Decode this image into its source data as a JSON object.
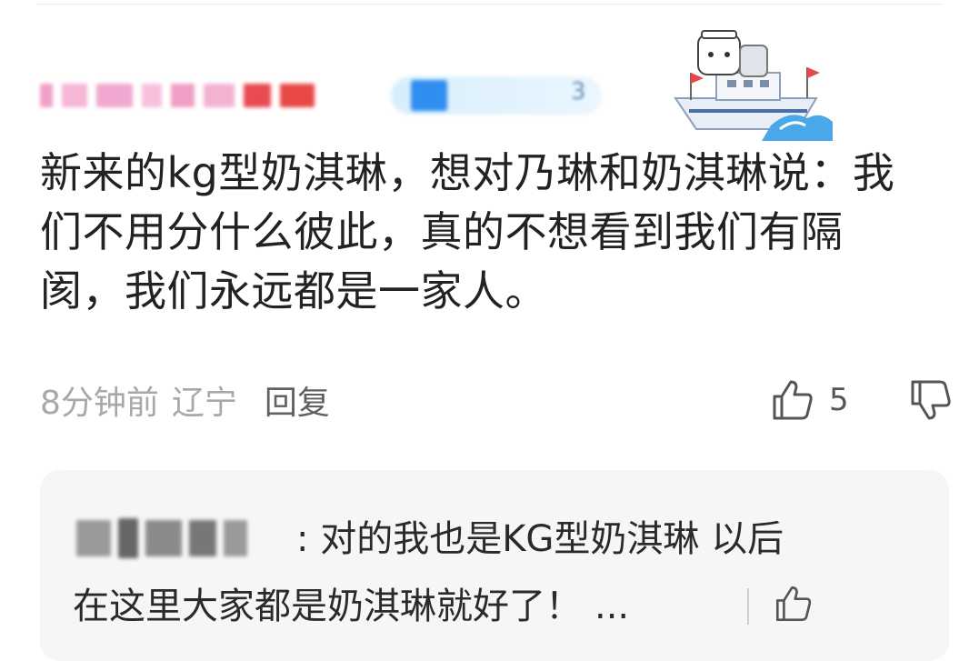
{
  "comment": {
    "text": "新来的kg型奶淇琳，想对乃琳和奶淇琳说：我们不用分什么彼此，真的不想看到我们有隔阂，我们永远都是一家人。",
    "time": "8分钟前",
    "location": "辽宁",
    "reply_label": "回复",
    "like_count": "5",
    "username_badge_level": "3"
  },
  "reply": {
    "line1": ": 对的我也是KG型奶淇琳 以后",
    "line2": "在这里大家都是奶淇琳就好了！",
    "more": "..."
  },
  "icons": {
    "like": "thumbs-up-icon",
    "dislike": "thumbs-down-icon",
    "avatar_decoration": "ship-mascot-icon"
  },
  "colors": {
    "text": "#222222",
    "meta": "#a8a8a8",
    "reply_bg": "#f5f6f8",
    "badge": "#2f8ef0"
  }
}
